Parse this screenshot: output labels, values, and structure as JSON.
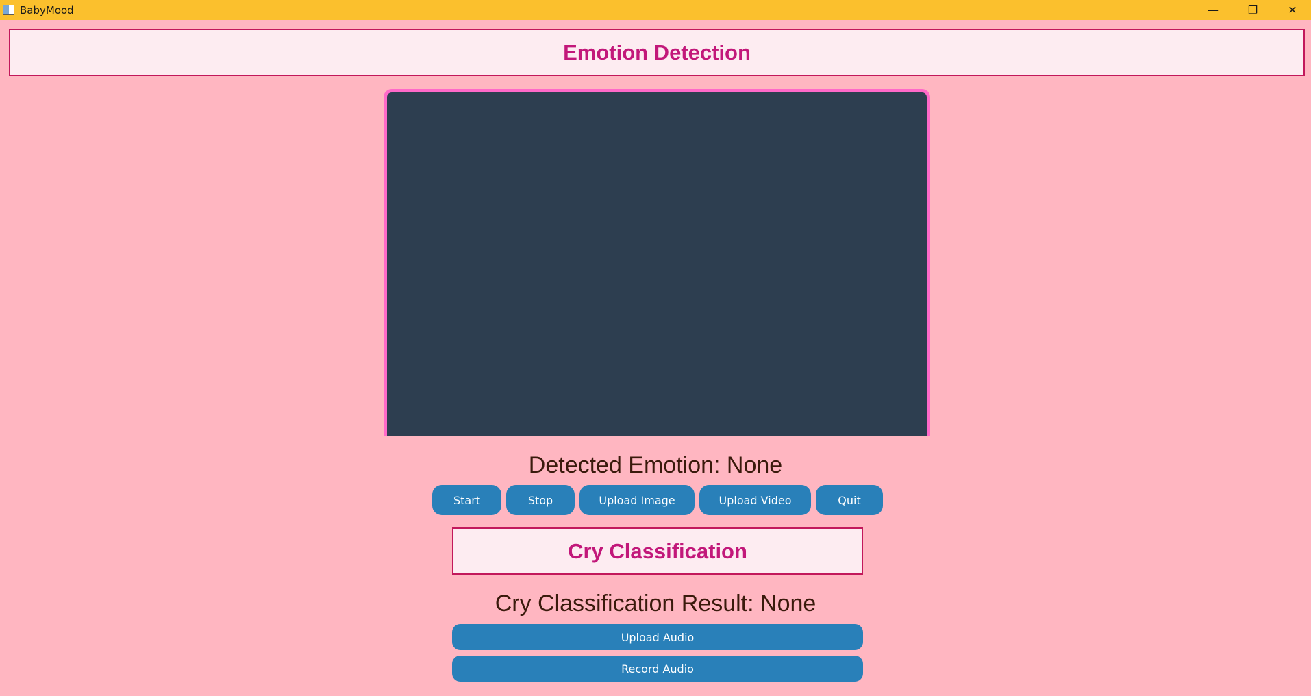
{
  "window": {
    "title": "BabyMood",
    "controls": {
      "minimize": "—",
      "maximize": "❐",
      "close": "✕"
    }
  },
  "emotion_section": {
    "header": "Emotion Detection",
    "detected_label": "Detected Emotion: None",
    "buttons": {
      "start": "Start",
      "stop": "Stop",
      "upload_image": "Upload Image",
      "upload_video": "Upload Video",
      "quit": "Quit"
    }
  },
  "cry_section": {
    "header": "Cry Classification",
    "result_label": "Cry Classification Result: None",
    "buttons": {
      "upload_audio": "Upload Audio",
      "record_audio": "Record Audio"
    }
  },
  "colors": {
    "background": "#ffb6c1",
    "titlebar": "#fbc02d",
    "header_text": "#c2187a",
    "header_border": "#c2185b",
    "button": "#2980b9",
    "video_bg": "#2d3e50",
    "video_border": "#ff69c9"
  }
}
